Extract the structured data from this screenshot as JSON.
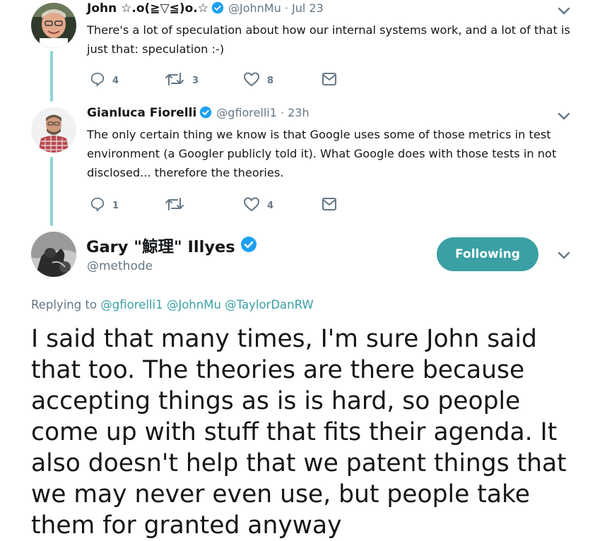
{
  "tweets": [
    {
      "name": "John ☆.o(≧▽≦)o.☆",
      "handle": "@JohnMu",
      "time": "· Jul 23",
      "text": "There's a lot of speculation about how our internal systems work, and a lot of that is just that: speculation :-)",
      "counts": {
        "reply": "4",
        "retweet": "3",
        "like": "8"
      }
    },
    {
      "name": "Gianluca Fiorelli",
      "handle": "@gfiorelli1",
      "time": "· 23h",
      "text": "The only certain thing we know is that Google uses some of those metrics in test environment (a Googler publicly told it). What Google does with those tests in not disclosed... therefore the theories.",
      "counts": {
        "reply": "1",
        "retweet": "",
        "like": "4"
      }
    }
  ],
  "main_tweet": {
    "name": "Gary \"鯨理\" Illyes",
    "handle": "@methode",
    "follow_label": "Following",
    "replying_prefix": "Replying to",
    "replying_to": [
      "@gfiorelli1",
      "@JohnMu",
      "@TaylorDanRW"
    ],
    "text": "I said that many times, I'm sure John said that too. The theories are there because accepting things as is is hard, so people come up with stuff that fits their agenda. It also doesn't help that we patent things that we may never even use, but people take them for granted anyway"
  },
  "colors": {
    "accent": "#3aa0a4",
    "thread_line": "#8fd3d6",
    "muted": "#657786",
    "verified": "#1da1f2"
  },
  "icons": [
    "reply-icon",
    "retweet-icon",
    "like-icon",
    "direct-message-icon",
    "verified-badge-icon",
    "chevron-down-icon"
  ]
}
